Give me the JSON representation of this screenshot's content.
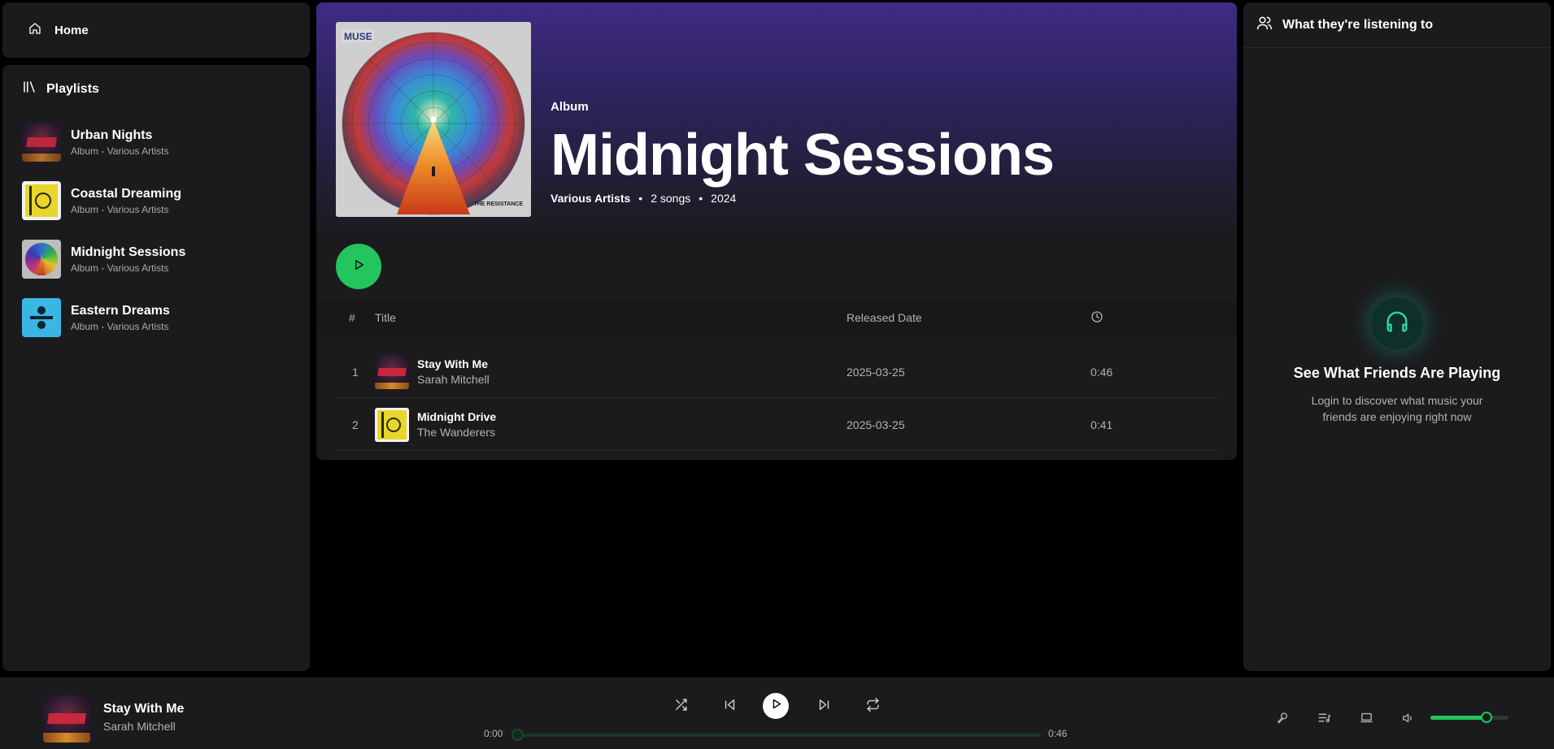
{
  "nav": {
    "home_label": "Home"
  },
  "playlists": {
    "header": "Playlists",
    "items": [
      {
        "name": "Urban Nights",
        "sub": "Album - Various Artists"
      },
      {
        "name": "Coastal Dreaming",
        "sub": "Album - Various Artists"
      },
      {
        "name": "Midnight Sessions",
        "sub": "Album - Various Artists"
      },
      {
        "name": "Eastern Dreams",
        "sub": "Album - Various Artists"
      }
    ]
  },
  "album": {
    "cover_brand": "MUSE",
    "cover_caption": "THE RESISTANCE",
    "type": "Album",
    "title": "Midnight Sessions",
    "artist": "Various Artists",
    "songs": "2 songs",
    "year": "2024"
  },
  "table": {
    "col_num": "#",
    "col_title": "Title",
    "col_date": "Released Date",
    "tracks": [
      {
        "num": "1",
        "title": "Stay With Me",
        "artist": "Sarah Mitchell",
        "date": "2025-03-25",
        "duration": "0:46"
      },
      {
        "num": "2",
        "title": "Midnight Drive",
        "artist": "The Wanderers",
        "date": "2025-03-25",
        "duration": "0:41"
      }
    ]
  },
  "friends": {
    "header": "What they're listening to",
    "title": "See What Friends Are Playing",
    "desc": "Login to discover what music your friends are enjoying right now"
  },
  "player": {
    "title": "Stay With Me",
    "artist": "Sarah Mitchell",
    "elapsed": "0:00",
    "total": "0:46",
    "progress": 0,
    "volume": 0.72
  },
  "icons": {
    "home": "home-icon",
    "library": "library-icon",
    "clock": "clock-icon",
    "users": "users-icon",
    "headphones": "headphones-icon",
    "shuffle": "shuffle-icon",
    "prev": "skip-back-icon",
    "play": "play-icon",
    "next": "skip-forward-icon",
    "repeat": "repeat-icon",
    "mic": "microphone-icon",
    "queue": "queue-icon",
    "device": "laptop-icon",
    "volume": "volume-icon"
  },
  "colors": {
    "accent": "#22c55e",
    "hero_top": "#3f2b85",
    "panel": "#1b1b1d"
  }
}
